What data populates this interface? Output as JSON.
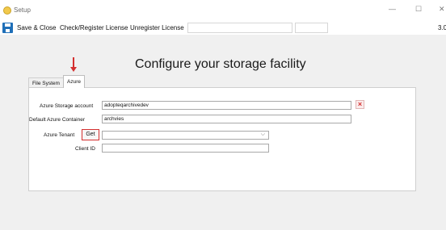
{
  "window": {
    "title": "Setup",
    "minimize": "—",
    "maximize": "☐",
    "close": "✕"
  },
  "menu": {
    "save_close": "Save & Close",
    "check_register": "Check/Register License",
    "unregister": "Unregister License",
    "version": "3.0"
  },
  "heading": "Configure your storage facility",
  "tabs": [
    {
      "label": "File System",
      "active": false
    },
    {
      "label": "Azure",
      "active": true
    }
  ],
  "form": {
    "storage_account_label": "Azure Storage account",
    "storage_account_value": "adopteqarchivedev",
    "container_label": "Default Azure Container",
    "container_value": "archvies",
    "tenant_label": "Azure Tenant",
    "get_label": "Get",
    "tenant_value": "",
    "client_id_label": "Client ID",
    "client_id_value": ""
  },
  "colors": {
    "accent": "#d32f2f",
    "save_icon": "#1f6fb8"
  }
}
